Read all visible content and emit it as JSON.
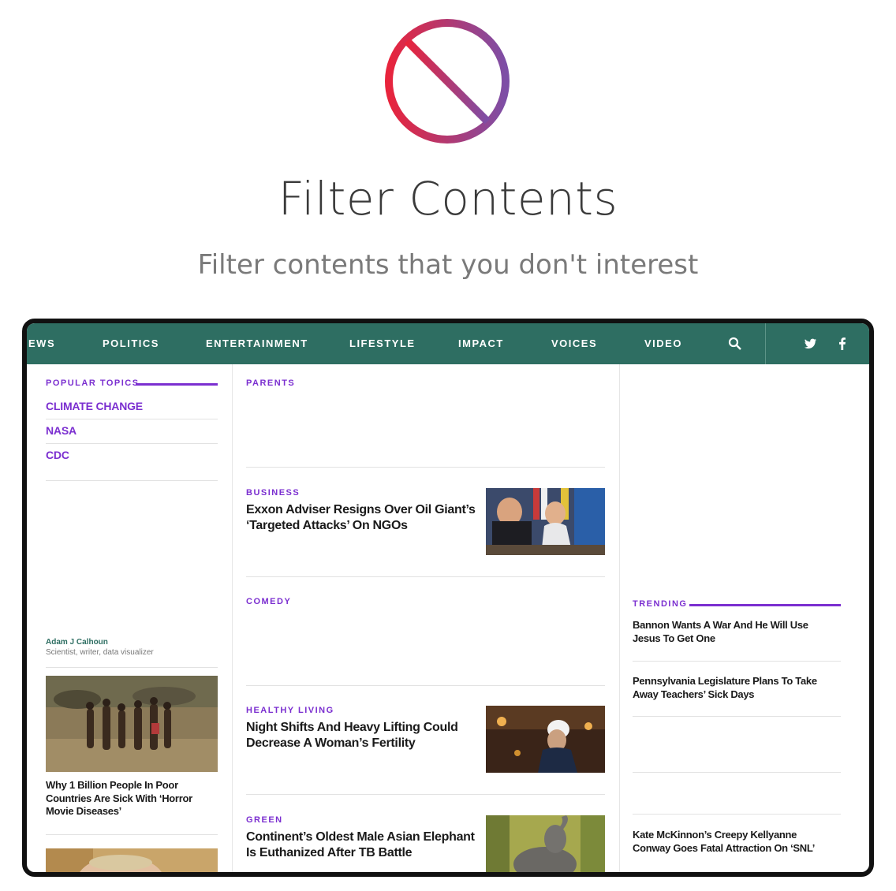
{
  "hero": {
    "title": "Filter Contents",
    "subtitle": "Filter contents that you don't interest",
    "icon": "prohibited-icon",
    "gradient_colors": [
      "#e8243c",
      "#7d4ea6"
    ]
  },
  "nav": {
    "items": [
      "EWS",
      "POLITICS",
      "ENTERTAINMENT",
      "LIFESTYLE",
      "IMPACT",
      "VOICES",
      "VIDEO"
    ],
    "icons": [
      "search-icon",
      "twitter-icon",
      "facebook-icon"
    ],
    "background": "#2e6e62"
  },
  "left": {
    "popular_label": "POPULAR TOPICS",
    "topics": [
      "CLIMATE CHANGE",
      "NASA",
      "CDC"
    ],
    "author_name": "Adam J Calhoun",
    "author_bio": "Scientist, writer, data visualizer",
    "story_headline": "Why 1 Billion People In Poor Countries Are Sick With ‘Horror Movie Diseases’"
  },
  "middle": {
    "parents_label": "PARENTS",
    "business_label": "BUSINESS",
    "business_headline": "Exxon Adviser Resigns Over Oil Giant’s ‘Targeted Attacks’ On NGOs",
    "comedy_label": "COMEDY",
    "healthy_label": "HEALTHY LIVING",
    "healthy_headline": "Night Shifts And Heavy Lifting Could Decrease A Woman’s Fertility",
    "green_label": "GREEN",
    "green_headline": "Continent’s Oldest Male Asian Elephant Is Euthanized After TB Battle"
  },
  "right": {
    "trending_label": "TRENDING",
    "trending": [
      "Bannon Wants A War And He Will Use Jesus To Get One",
      "Pennsylvania Legislature Plans To Take Away Teachers’ Sick Days",
      "Kate McKinnon’s Creepy Kellyanne Conway Goes Fatal Attraction On ‘SNL’"
    ]
  },
  "accent": "#7b2fd0"
}
